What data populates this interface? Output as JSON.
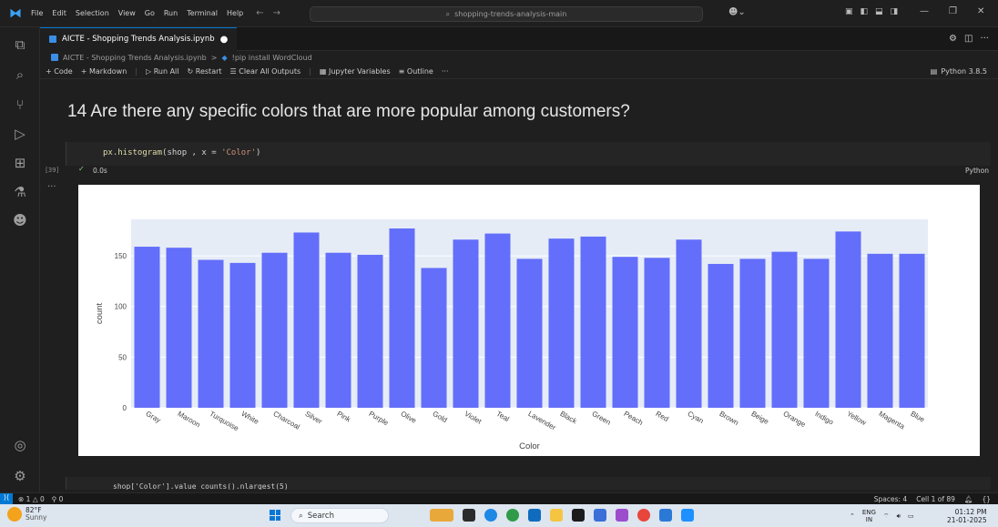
{
  "titlebar": {
    "menu": [
      "File",
      "Edit",
      "Selection",
      "View",
      "Go",
      "Run",
      "Terminal",
      "Help"
    ],
    "search": "shopping-trends-analysis-main"
  },
  "tab": {
    "title": "AICTE - Shopping Trends Analysis.ipynb",
    "modified": "●"
  },
  "breadcrumb": {
    "file": "AICTE - Shopping Trends Analysis.ipynb",
    "sep": ">",
    "cell": "!pip install WordCloud"
  },
  "toolbar": {
    "code": "+ Code",
    "markdown": "+ Markdown",
    "run_all": "Run All",
    "restart": "Restart",
    "clear": "Clear All Outputs",
    "variables": "Jupyter Variables",
    "outline": "Outline",
    "more": "···",
    "kernel": "Python 3.8.5"
  },
  "notebook": {
    "heading": "14 Are there any specific colors that are more popular among customers?",
    "code": {
      "fn": "px.histogram",
      "args_pre": "(shop , x = ",
      "str": "'Color'",
      "close": ")"
    },
    "exec_count": "[39]",
    "status_time": "0.0s",
    "language": "Python",
    "next_code": "shop['Color'].value_counts().nlargest(5)"
  },
  "chart_data": {
    "type": "bar",
    "categories": [
      "Gray",
      "Maroon",
      "Turquoise",
      "White",
      "Charcoal",
      "Silver",
      "Pink",
      "Purple",
      "Olive",
      "Gold",
      "Violet",
      "Teal",
      "Lavender",
      "Black",
      "Green",
      "Peach",
      "Red",
      "Cyan",
      "Brown",
      "Beige",
      "Orange",
      "Indigo",
      "Yellow",
      "Magenta",
      "Blue"
    ],
    "values": [
      159,
      158,
      146,
      143,
      153,
      173,
      153,
      151,
      177,
      138,
      166,
      172,
      147,
      167,
      169,
      149,
      148,
      166,
      142,
      147,
      154,
      147,
      174,
      152,
      152
    ],
    "xlabel": "Color",
    "ylabel": "count",
    "yticks": [
      "0",
      "50",
      "100",
      "150"
    ],
    "ylim": [
      0,
      186
    ],
    "grid": true,
    "colors": {
      "bar": "#636efa",
      "plot_bg": "#e5ecf6"
    }
  },
  "statusbar": {
    "problems": "⊗ 1 △ 0",
    "ports": "⚲ 0",
    "spaces": "Spaces: 4",
    "cell": "Cell 1 of 89"
  },
  "taskbar": {
    "temp": "82°F",
    "weather": "Sunny",
    "search": "Search",
    "lang": "ENG",
    "region": "IN",
    "time": "01:12 PM",
    "date": "21-01-2025"
  }
}
